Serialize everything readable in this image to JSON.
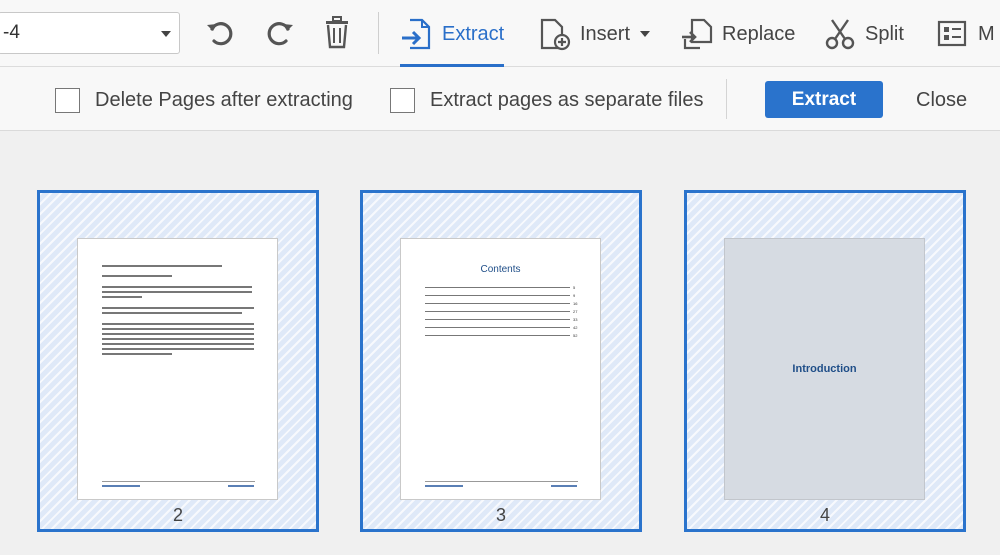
{
  "toolbar": {
    "page_range_value": "-4",
    "tools": {
      "extract_label": "Extract",
      "insert_label": "Insert",
      "replace_label": "Replace",
      "split_label": "Split",
      "more_label": "M"
    },
    "accent_color": "#2a6fc9"
  },
  "options": {
    "delete_pages_label": "Delete Pages after extracting",
    "separate_files_label": "Extract pages as separate files",
    "extract_button_label": "Extract",
    "close_button_label": "Close"
  },
  "thumbnails": [
    {
      "page_number": "2",
      "selected": true
    },
    {
      "page_number": "3",
      "selected": true,
      "heading": "Contents",
      "toc_pages": [
        "5",
        "9",
        "16",
        "27",
        "33",
        "42",
        "52"
      ]
    },
    {
      "page_number": "4",
      "selected": true,
      "heading": "Introduction"
    }
  ]
}
